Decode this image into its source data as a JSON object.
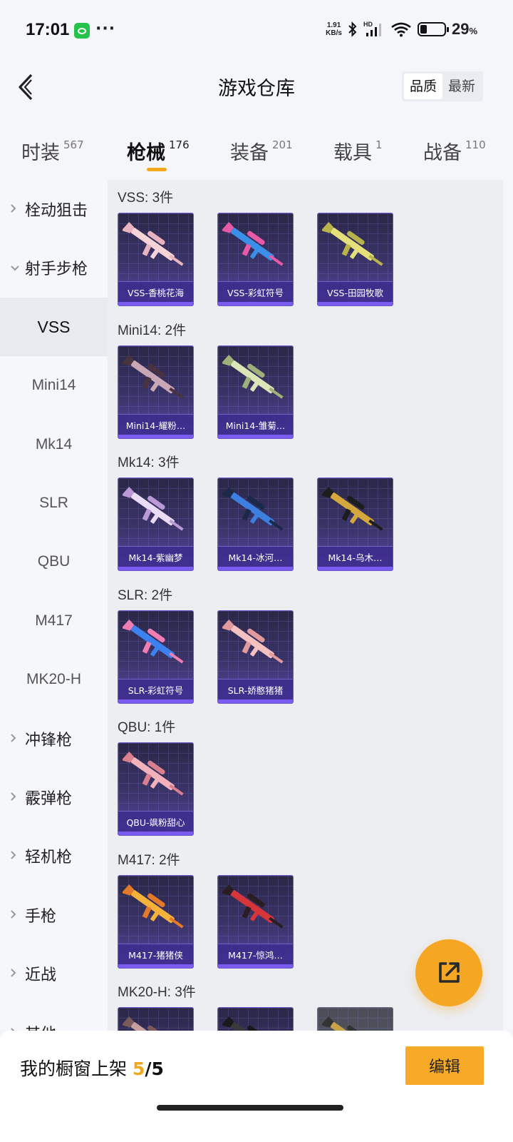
{
  "status_bar": {
    "time": "17:01",
    "app_icon": "wechat-icon",
    "net_speed_value": "1.91",
    "net_speed_unit": "KB/s",
    "network_label": "HD",
    "battery_percent": "29",
    "battery_unit": "%",
    "battery_level": 0.29
  },
  "header": {
    "title": "游戏仓库",
    "sort_options": [
      "品质",
      "最新"
    ],
    "sort_selected": "品质"
  },
  "tabs": [
    {
      "label": "时装",
      "count": "567"
    },
    {
      "label": "枪械",
      "count": "176",
      "active": true
    },
    {
      "label": "装备",
      "count": "201"
    },
    {
      "label": "载具",
      "count": "1"
    },
    {
      "label": "战备",
      "count": "110"
    }
  ],
  "sidebar": {
    "items": [
      {
        "label": "栓动狙击",
        "type": "category",
        "expanded": false
      },
      {
        "label": "射手步枪",
        "type": "category",
        "expanded": true
      },
      {
        "label": "VSS",
        "type": "sub",
        "selected": true
      },
      {
        "label": "Mini14",
        "type": "sub"
      },
      {
        "label": "Mk14",
        "type": "sub"
      },
      {
        "label": "SLR",
        "type": "sub"
      },
      {
        "label": "QBU",
        "type": "sub"
      },
      {
        "label": "M417",
        "type": "sub"
      },
      {
        "label": "MK20-H",
        "type": "sub"
      },
      {
        "label": "冲锋枪",
        "type": "category",
        "expanded": false
      },
      {
        "label": "霰弹枪",
        "type": "category",
        "expanded": false
      },
      {
        "label": "轻机枪",
        "type": "category",
        "expanded": false
      },
      {
        "label": "手枪",
        "type": "category",
        "expanded": false
      },
      {
        "label": "近战",
        "type": "category",
        "expanded": false
      },
      {
        "label": "其他",
        "type": "category",
        "expanded": false
      }
    ]
  },
  "groups": [
    {
      "title": "VSS: 3件",
      "items": [
        {
          "name": "VSS-香桃花海",
          "colors": [
            "#f6d3d6",
            "#e8b4c0"
          ]
        },
        {
          "name": "VSS-彩虹符号",
          "colors": [
            "#3a8fe8",
            "#e85aa6"
          ]
        },
        {
          "name": "VSS-田园牧歌",
          "colors": [
            "#e6e07a",
            "#b8b34a"
          ]
        }
      ]
    },
    {
      "title": "Mini14: 2件",
      "items": [
        {
          "name": "Mini14-耀粉…",
          "colors": [
            "#c9a7b4",
            "#4a3340"
          ]
        },
        {
          "name": "Mini14-雏菊…",
          "colors": [
            "#dbe6b8",
            "#9fb07a"
          ]
        }
      ]
    },
    {
      "title": "Mk14: 3件",
      "items": [
        {
          "name": "Mk14-紫幽梦",
          "colors": [
            "#eadcf6",
            "#b99ad6"
          ]
        },
        {
          "name": "Mk14-冰河…",
          "colors": [
            "#3c7fe0",
            "#1b2a48"
          ]
        },
        {
          "name": "Mk14-乌木…",
          "colors": [
            "#d4a83a",
            "#1d1d1d"
          ]
        }
      ]
    },
    {
      "title": "SLR: 2件",
      "items": [
        {
          "name": "SLR-彩虹符号",
          "colors": [
            "#3b82f0",
            "#ef7fb2"
          ]
        },
        {
          "name": "SLR-娇憨猪猪",
          "colors": [
            "#f2c1c0",
            "#e39a9c"
          ]
        }
      ]
    },
    {
      "title": "QBU: 1件",
      "items": [
        {
          "name": "QBU-飒粉甜心",
          "colors": [
            "#f2b2bb",
            "#d97f8e"
          ]
        }
      ]
    },
    {
      "title": "M417: 2件",
      "items": [
        {
          "name": "M417-猪猪侠",
          "colors": [
            "#f4b23a",
            "#e27a2a"
          ]
        },
        {
          "name": "M417-惊鸿…",
          "colors": [
            "#d6353a",
            "#2a1e22"
          ]
        }
      ]
    },
    {
      "title": "MK20-H: 3件",
      "items": [
        {
          "name": "",
          "colors": [
            "#c8a0a0",
            "#7a5a5a"
          ]
        },
        {
          "name": "",
          "colors": [
            "#3a3a3a",
            "#1a1a1a"
          ]
        },
        {
          "name": "",
          "colors": [
            "#c9a24a",
            "#333333"
          ],
          "gray": true
        }
      ]
    }
  ],
  "bottom_bar": {
    "label": "我的橱窗上架",
    "current": "5",
    "separator": "/",
    "total": "5",
    "edit_label": "编辑"
  },
  "fab": {
    "icon": "share-external-icon"
  },
  "accent_color": "#f2a81c"
}
